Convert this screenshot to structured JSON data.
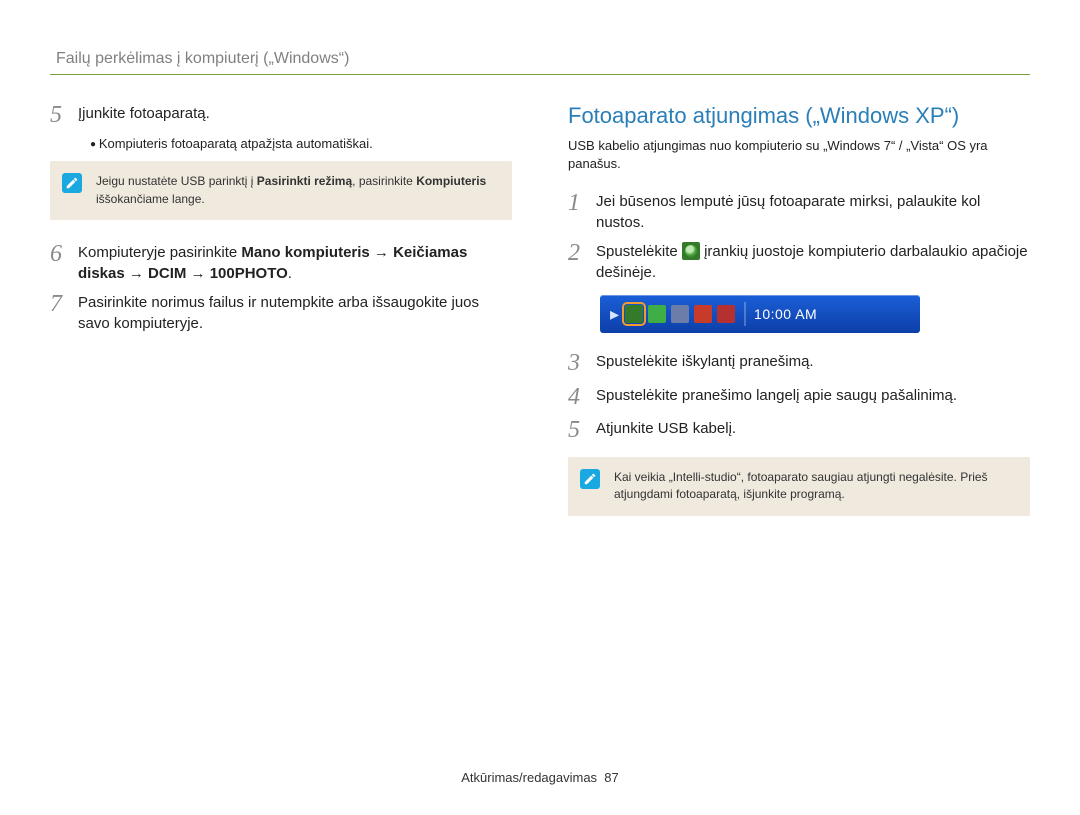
{
  "header": {
    "title": "Failų perkėlimas į kompiuterį („Windows“)"
  },
  "left": {
    "steps": [
      {
        "num": "5",
        "text": "Įjunkite fotoaparatą.",
        "sub": "Kompiuteris fotoaparatą atpažįsta automatiškai."
      },
      {
        "num": "6",
        "pre": "Kompiuteryje pasirinkite ",
        "bold": "Mano kompiuteris → Keičiamas diskas → DCIM → 100PHOTO",
        "post": "."
      },
      {
        "num": "7",
        "text": "Pasirinkite norimus failus ir nutempkite arba išsaugokite juos savo kompiuteryje."
      }
    ],
    "note": {
      "pre": "Jeigu nustatėte USB parinktį į ",
      "bold1": "Pasirinkti režimą",
      "mid": ", pasirinkite ",
      "bold2": "Kompiuteris",
      "post": " iššokančiame lange."
    }
  },
  "right": {
    "title": "Fotoaparato atjungimas („Windows XP“)",
    "subtext": "USB kabelio atjungimas nuo kompiuterio su „Windows 7“ / „Vista“ OS yra panašus.",
    "steps": [
      {
        "num": "1",
        "text": "Jei būsenos lemputė jūsų fotoaparate mirksi, palaukite kol nustos."
      },
      {
        "num": "2",
        "pre": "Spustelėkite ",
        "post": " įrankių juostoje kompiuterio darbalaukio apačioje dešinėje."
      },
      {
        "num": "3",
        "text": "Spustelėkite iškylantį pranešimą."
      },
      {
        "num": "4",
        "text": "Spustelėkite pranešimo langelį apie saugų pašalinimą."
      },
      {
        "num": "5",
        "text": "Atjunkite USB kabelį."
      }
    ],
    "taskbar": {
      "clock": "10:00 AM"
    },
    "note": {
      "text": "Kai veikia „Intelli-studio“, fotoaparato saugiau atjungti negalėsite. Prieš atjungdami fotoaparatą, išjunkite programą."
    }
  },
  "footer": {
    "section": "Atkūrimas/redagavimas",
    "page": "87"
  }
}
